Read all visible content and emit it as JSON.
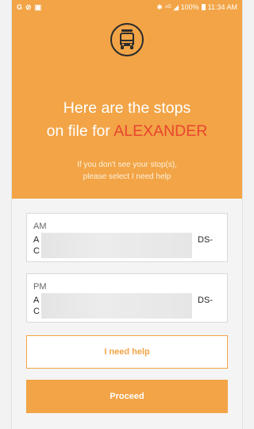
{
  "status_bar": {
    "left_icons": [
      "G",
      "⊘",
      "▣"
    ],
    "right_text": "✱ ⁴ᴳ ◢ 100%",
    "time": "11:34 AM"
  },
  "header": {
    "logo_icon": "school-bus-icon",
    "line1": "Here are the stops",
    "line2_prefix": "on file for ",
    "name": "ALEXANDER",
    "sub_line1": "If you don't see your stop(s),",
    "sub_line2": "please select I need help"
  },
  "stops": {
    "am": {
      "label": "AM",
      "line1": "A",
      "line2": "C",
      "suffix": "DS-"
    },
    "pm": {
      "label": "PM",
      "line1": "A",
      "line2": "C",
      "suffix": "DS-"
    }
  },
  "buttons": {
    "help": "I need help",
    "proceed": "Proceed"
  },
  "colors": {
    "brand": "#f2a446",
    "name_highlight": "#e8452e"
  }
}
